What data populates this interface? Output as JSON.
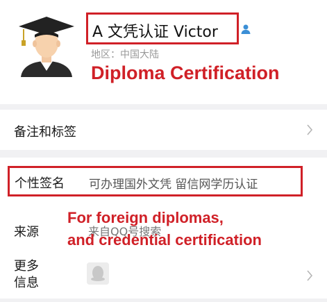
{
  "profile": {
    "name": "A 文凭认证 Victor",
    "region": "地区：中国大陆",
    "avatar_icon": "graduate-avatar-icon",
    "contact_icon": "contact-person-icon"
  },
  "rows": {
    "remark": {
      "label": "备注和标签"
    },
    "signature": {
      "label": "个性签名",
      "value": "可办理国外文凭 留信网学历认证"
    },
    "source": {
      "label": "来源",
      "value": "来自QQ号搜索"
    },
    "more": {
      "label": "更多信息",
      "icon": "qq-penguin-icon"
    }
  },
  "annotations": {
    "title": "Diploma Certification",
    "foreign_line1": "For foreign diplomas,",
    "foreign_line2": "and credential certification"
  },
  "colors": {
    "annotation_red": "#d02027",
    "background": "#f1f1f3"
  }
}
